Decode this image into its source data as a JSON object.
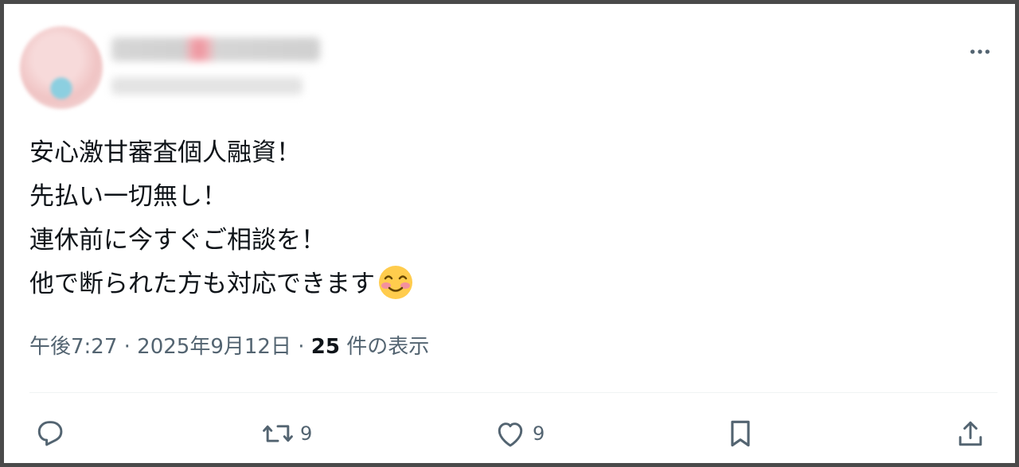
{
  "post": {
    "lines": [
      "安心激甘審査個人融資！",
      "先払い一切無し！",
      "連休前に今すぐご相談を！",
      "他で断られた方も対応できます"
    ],
    "emoji": "smiling-blush-emoji",
    "timestamp": "午後7:27 · 2025年9月12日 · ",
    "views_count": "25",
    "views_label": " 件の表示"
  },
  "actions": {
    "reply_count": "",
    "retweet_count": "9",
    "like_count": "9"
  },
  "icons": [
    "more-icon",
    "reply-icon",
    "retweet-icon",
    "like-icon",
    "bookmark-icon",
    "share-icon"
  ],
  "colors": {
    "text": "#0f1419",
    "secondary": "#536471",
    "divider": "#eff3f4"
  }
}
